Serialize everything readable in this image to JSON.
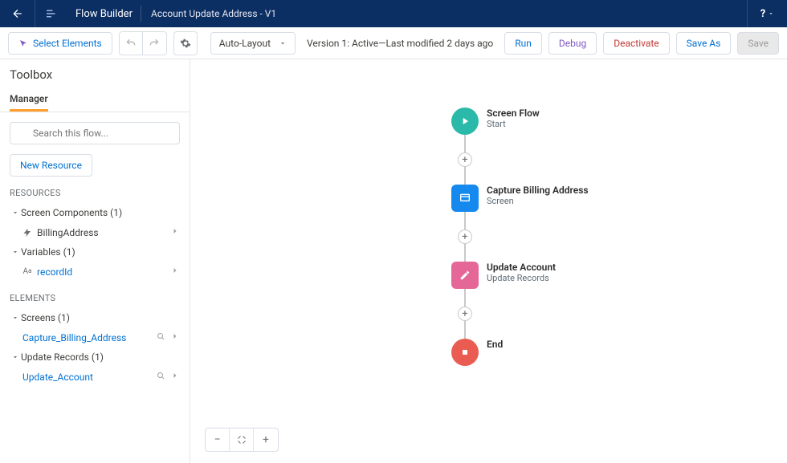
{
  "header": {
    "app_title": "Flow Builder",
    "flow_name": "Account Update Address - V1",
    "help_label": "?"
  },
  "toolbar": {
    "select_elements": "Select Elements",
    "layout_mode": "Auto-Layout",
    "status": "Version 1: Active—Last modified 2 days ago",
    "run": "Run",
    "debug": "Debug",
    "deactivate": "Deactivate",
    "save_as": "Save As",
    "save": "Save"
  },
  "sidebar": {
    "title": "Toolbox",
    "tab": "Manager",
    "search_placeholder": "Search this flow...",
    "new_resource": "New Resource",
    "resources_label": "RESOURCES",
    "groups": [
      {
        "label": "Screen Components (1)",
        "items": [
          {
            "name": "BillingAddress"
          }
        ]
      },
      {
        "label": "Variables (1)",
        "items": [
          {
            "name": "recordId",
            "link": true
          }
        ]
      }
    ],
    "elements_label": "ELEMENTS",
    "element_groups": [
      {
        "label": "Screens (1)",
        "items": [
          {
            "name": "Capture_Billing_Address",
            "link": true,
            "actions": true
          }
        ]
      },
      {
        "label": "Update Records (1)",
        "items": [
          {
            "name": "Update_Account",
            "link": true,
            "actions": true
          }
        ]
      }
    ]
  },
  "flow": {
    "nodes": [
      {
        "shape": "circle",
        "color": "nb-start",
        "title": "Screen Flow",
        "subtitle": "Start",
        "icon": "play"
      },
      {
        "shape": "square",
        "color": "nb-screen",
        "title": "Capture Billing Address",
        "subtitle": "Screen",
        "icon": "screen"
      },
      {
        "shape": "square",
        "color": "nb-update",
        "title": "Update Account",
        "subtitle": "Update Records",
        "icon": "edit"
      },
      {
        "shape": "circle",
        "color": "nb-end",
        "title": "End",
        "subtitle": "",
        "icon": "stop"
      }
    ]
  }
}
